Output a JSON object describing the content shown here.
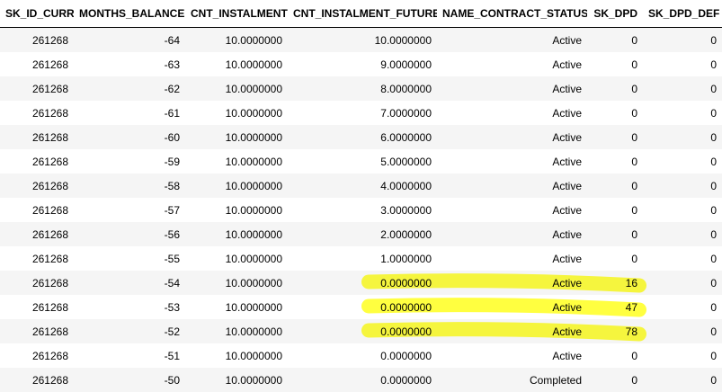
{
  "table": {
    "columns": [
      "SK_ID_CURR",
      "MONTHS_BALANCE",
      "CNT_INSTALMENT",
      "CNT_INSTALMENT_FUTURE",
      "NAME_CONTRACT_STATUS",
      "SK_DPD",
      "SK_DPD_DEF"
    ],
    "rows": [
      [
        "261268",
        "-64",
        "10.0000000",
        "10.0000000",
        "Active",
        "0",
        "0"
      ],
      [
        "261268",
        "-63",
        "10.0000000",
        "9.0000000",
        "Active",
        "0",
        "0"
      ],
      [
        "261268",
        "-62",
        "10.0000000",
        "8.0000000",
        "Active",
        "0",
        "0"
      ],
      [
        "261268",
        "-61",
        "10.0000000",
        "7.0000000",
        "Active",
        "0",
        "0"
      ],
      [
        "261268",
        "-60",
        "10.0000000",
        "6.0000000",
        "Active",
        "0",
        "0"
      ],
      [
        "261268",
        "-59",
        "10.0000000",
        "5.0000000",
        "Active",
        "0",
        "0"
      ],
      [
        "261268",
        "-58",
        "10.0000000",
        "4.0000000",
        "Active",
        "0",
        "0"
      ],
      [
        "261268",
        "-57",
        "10.0000000",
        "3.0000000",
        "Active",
        "0",
        "0"
      ],
      [
        "261268",
        "-56",
        "10.0000000",
        "2.0000000",
        "Active",
        "0",
        "0"
      ],
      [
        "261268",
        "-55",
        "10.0000000",
        "1.0000000",
        "Active",
        "0",
        "0"
      ],
      [
        "261268",
        "-54",
        "10.0000000",
        "0.0000000",
        "Active",
        "16",
        "0"
      ],
      [
        "261268",
        "-53",
        "10.0000000",
        "0.0000000",
        "Active",
        "47",
        "0"
      ],
      [
        "261268",
        "-52",
        "10.0000000",
        "0.0000000",
        "Active",
        "78",
        "0"
      ],
      [
        "261268",
        "-51",
        "10.0000000",
        "0.0000000",
        "Active",
        "0",
        "0"
      ],
      [
        "261268",
        "-50",
        "10.0000000",
        "0.0000000",
        "Completed",
        "0",
        "0"
      ]
    ]
  },
  "highlight": {
    "color": "#ffff00",
    "rows": [
      "-54",
      "-53",
      "-52"
    ]
  }
}
